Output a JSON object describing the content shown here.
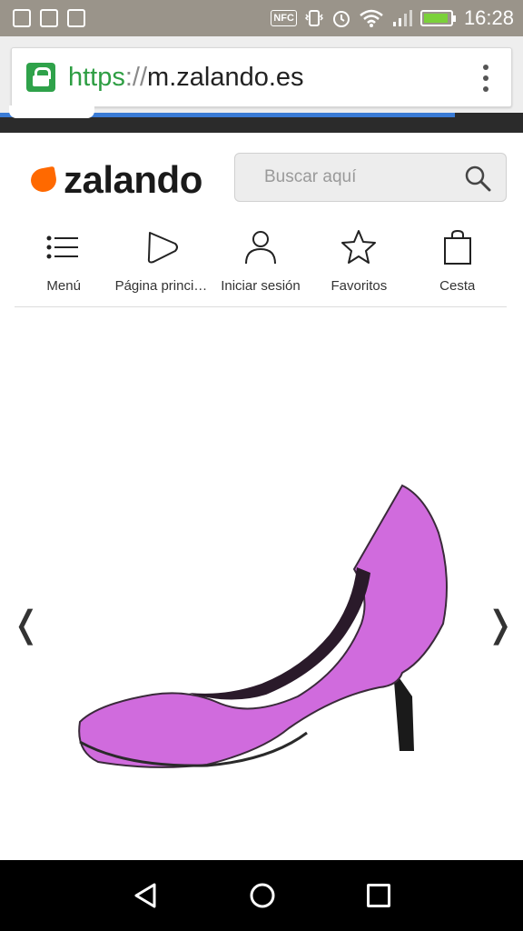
{
  "status_bar": {
    "time": "16:28",
    "nfc_label": "NFC",
    "icons": [
      "image-icon",
      "image-icon",
      "briefcase-icon",
      "nfc-icon",
      "vibrate-icon",
      "alarm-icon",
      "wifi-icon",
      "signal-icon",
      "battery-charging-icon"
    ]
  },
  "browser": {
    "url_scheme": "https",
    "url_separator": "://",
    "url_host": "m.zalando.es",
    "load_progress": 0.87,
    "colors": {
      "lock": "#2fa24a",
      "scheme": "#2e9e43",
      "progress": "#3a7bd5"
    }
  },
  "site": {
    "logo_text": "zalando",
    "brand_color": "#ff6900",
    "search": {
      "placeholder": "Buscar aquí"
    },
    "nav": [
      {
        "label": "Menú",
        "icon": "menu-list-icon"
      },
      {
        "label": "Página principal",
        "icon": "home-play-icon"
      },
      {
        "label": "Iniciar sesión",
        "icon": "user-icon"
      },
      {
        "label": "Favoritos",
        "icon": "star-icon"
      },
      {
        "label": "Cesta",
        "icon": "shopping-bag-icon"
      }
    ]
  },
  "product": {
    "prev_arrow": "❬",
    "next_arrow": "❭",
    "image": "pink-high-heel-shoe",
    "shoe_color": "#d46be0"
  },
  "system_nav": {
    "icons": [
      "back-icon",
      "home-icon",
      "recent-apps-icon"
    ]
  }
}
